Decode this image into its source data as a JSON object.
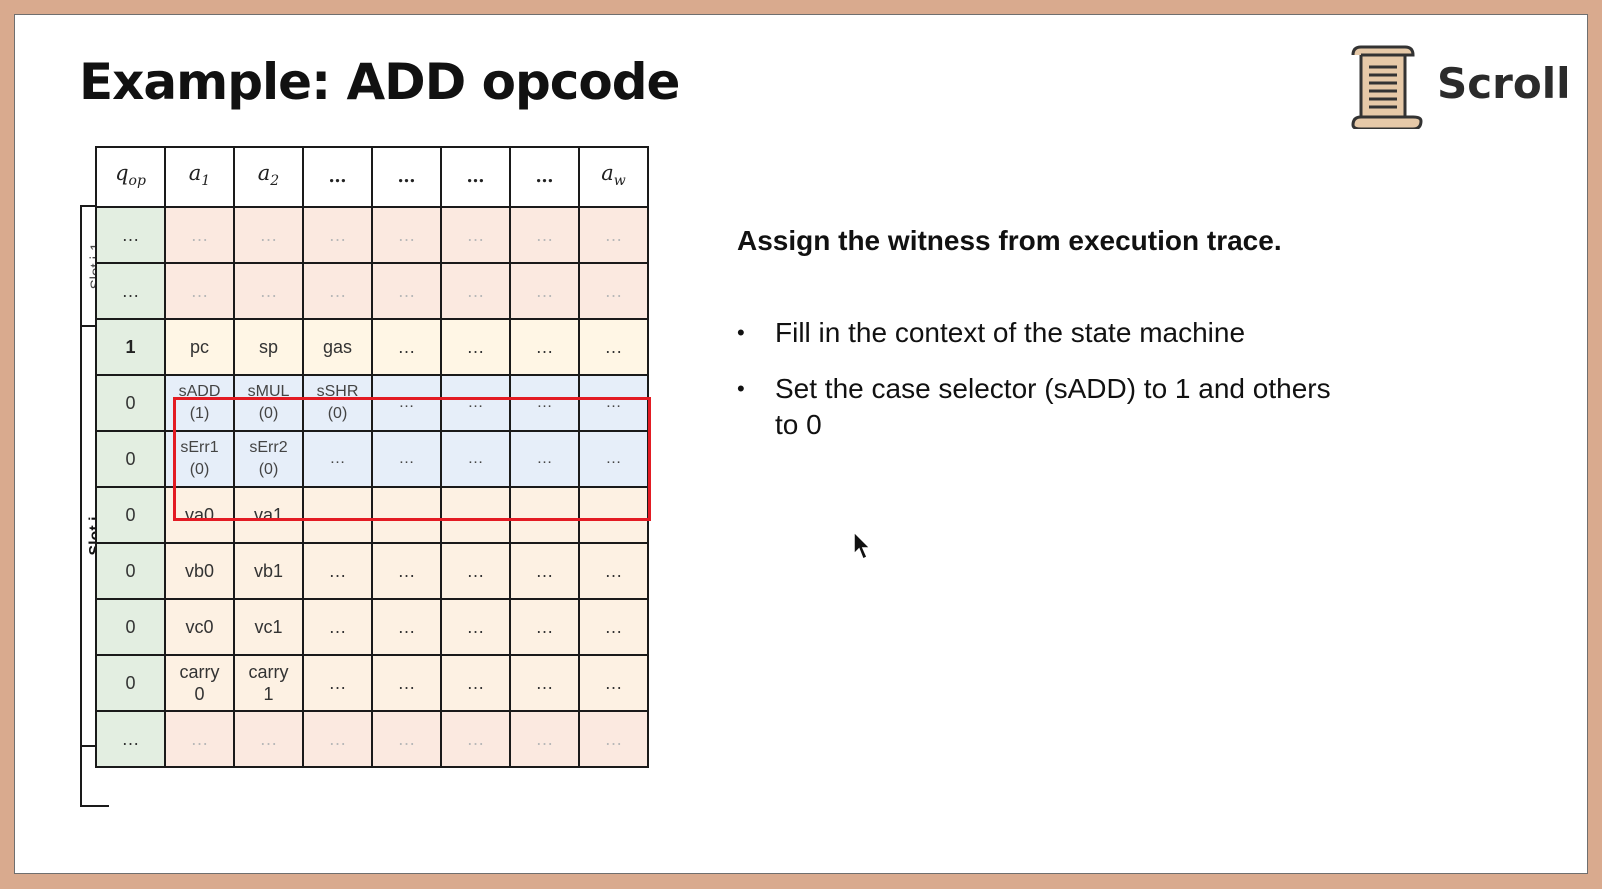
{
  "slide": {
    "title": "Example: ADD opcode",
    "logo_text": "Scroll",
    "logo_icon": "scroll-icon"
  },
  "table": {
    "header": {
      "q": {
        "base": "q",
        "sub": "op"
      },
      "a1": {
        "base": "a",
        "sub": "1"
      },
      "a2": {
        "base": "a",
        "sub": "2"
      },
      "dots": "…",
      "aw": {
        "base": "a",
        "sub": "w"
      }
    },
    "slot_labels": [
      "Slot i-1",
      "Slot i"
    ],
    "rows": [
      {
        "q": "…",
        "cells": [
          "…",
          "…",
          "…",
          "…",
          "…",
          "…",
          "…"
        ]
      },
      {
        "q": "…",
        "cells": [
          "…",
          "…",
          "…",
          "…",
          "…",
          "…",
          "…"
        ]
      },
      {
        "q": "1",
        "cells": [
          "pc",
          "sp",
          "gas",
          "…",
          "…",
          "…",
          "…"
        ]
      },
      {
        "q": "0",
        "cells": [
          [
            "sADD",
            "(1)"
          ],
          [
            "sMUL",
            "(0)"
          ],
          [
            "sSHR",
            "(0)"
          ],
          "…",
          "…",
          "…",
          "…"
        ]
      },
      {
        "q": "0",
        "cells": [
          [
            "sErr1",
            "(0)"
          ],
          [
            "sErr2",
            "(0)"
          ],
          "…",
          "…",
          "…",
          "…",
          "…"
        ]
      },
      {
        "q": "0",
        "cells": [
          "va0",
          "va1",
          "…",
          "…",
          "…",
          "…",
          "…"
        ]
      },
      {
        "q": "0",
        "cells": [
          "vb0",
          "vb1",
          "…",
          "…",
          "…",
          "…",
          "…"
        ]
      },
      {
        "q": "0",
        "cells": [
          "vc0",
          "vc1",
          "…",
          "…",
          "…",
          "…",
          "…"
        ]
      },
      {
        "q": "0",
        "cells": [
          [
            "carry",
            "0"
          ],
          [
            "carry",
            "1"
          ],
          "…",
          "…",
          "…",
          "…",
          "…"
        ]
      },
      {
        "q": "…",
        "cells": [
          "…",
          "…",
          "…",
          "…",
          "…",
          "…",
          "…"
        ]
      }
    ]
  },
  "content": {
    "heading": "Assign the witness from execution trace.",
    "bullets": [
      "Fill in the context of the state machine",
      "Set the case selector (sADD) to 1 and others to 0"
    ],
    "bullet_glyph": "•"
  },
  "colors": {
    "highlight": "#e31b23",
    "q_column": "#e3eee1",
    "selector_rows": "#e6eef9",
    "data_rows": "#fdf1e3"
  }
}
